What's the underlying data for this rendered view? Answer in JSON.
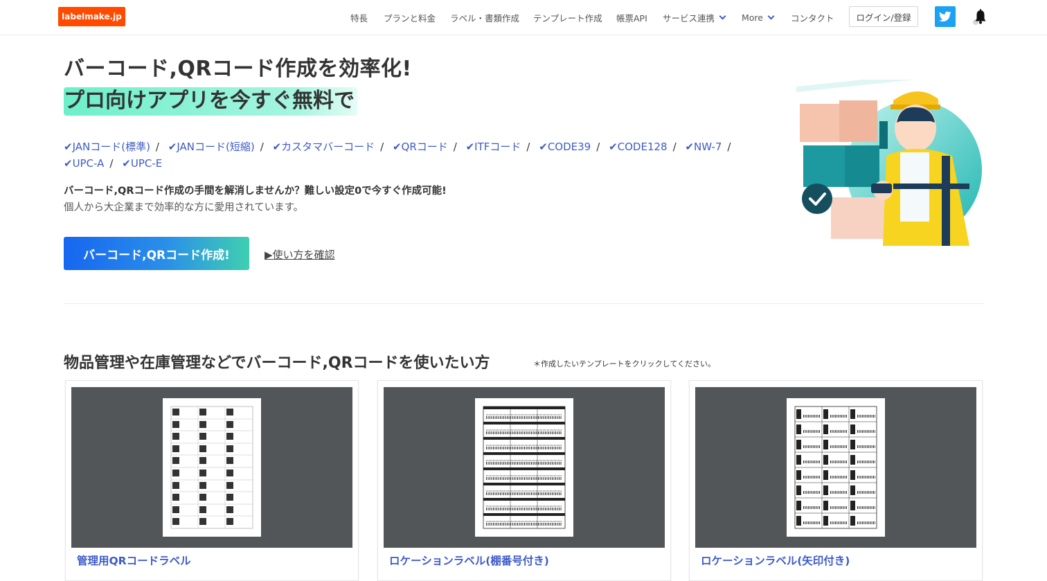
{
  "header": {
    "logo": "labelmake.jp",
    "nav": [
      "特長",
      "プランと料金",
      "ラベル・書類作成",
      "テンプレート作成",
      "帳票API"
    ],
    "nav_services": "サービス連携",
    "nav_more": "More",
    "nav_contact": "コンタクト",
    "login_label": "ログイン/登録"
  },
  "hero": {
    "title": "バーコード,QRコード作成を効率化!",
    "subtitle": "プロ向けアプリを今すぐ無料で",
    "codes": [
      "✔JANコード(標準)",
      "✔JANコード(短縮)",
      "✔カスタマバーコード",
      "✔QRコード",
      "✔ITFコード",
      "✔CODE39",
      "✔CODE128",
      "✔NW-7",
      "✔UPC-A",
      "✔UPC-E"
    ],
    "desc_bold": "バーコード,QRコード作成の手間を解消しませんか？難しい設定0で今すぐ作成可能!",
    "desc": "個人から大企業まで効率的な方に愛用されています。",
    "cta_label": "バーコード,QRコード作成!",
    "howto_label": "▶使い方を確認"
  },
  "section": {
    "title": "物品管理や在庫管理などでバーコード,QRコードを使いたい方",
    "note": "＊作成したいテンプレートをクリックしてください。",
    "cards": [
      {
        "title": "管理用QRコードラベル"
      },
      {
        "title": "ロケーションラベル(棚番号付き)"
      },
      {
        "title": "ロケーションラベル(矢印付き)"
      }
    ]
  },
  "colors": {
    "logo_bg": "#ff4a00",
    "link": "#3d5bc8",
    "twitter": "#1da1f2",
    "highlight": "#6cf0c9",
    "cta_start": "#1766f0",
    "cta_end": "#3fcfb0"
  },
  "icons": [
    "twitter-icon",
    "bell-icon",
    "chevron-down-icon",
    "check-icon"
  ]
}
